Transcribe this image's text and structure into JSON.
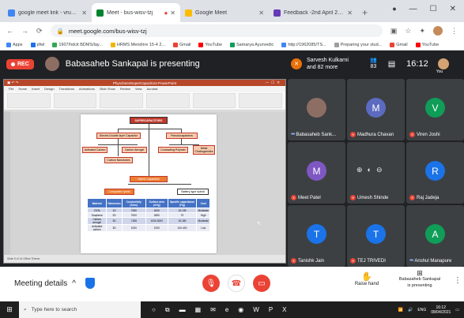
{
  "browser": {
    "tabs": [
      {
        "title": "google meet link - vrushali@...",
        "fav_color": "#4285f4",
        "active": false
      },
      {
        "title": "Meet - bus-wisv-tzj",
        "fav_color": "#00832d",
        "active": true
      },
      {
        "title": "Google Meet",
        "fav_color": "#fbbc04",
        "active": false
      },
      {
        "title": "Feedback -2nd April 2021 - Goo...",
        "fav_color": "#673ab7",
        "active": false
      }
    ],
    "url": "meet.google.com/bus-wisv-tzj",
    "bookmarks": [
      "Apps",
      "pfwl",
      "1907/hdcit BDMS/lay...",
      "HRMS Mendrire 15-4 2...",
      "Gmail",
      "YouTube",
      "Samarya Ayurvedic",
      "http://1962085/TS...",
      "Preparing your stud...",
      "Gmail",
      "YouTube"
    ],
    "win_controls": [
      "—",
      "☐",
      "✕"
    ]
  },
  "meet": {
    "rec_label": "REC",
    "presenting_text": "Babasaheb Sankapal is presenting",
    "host_line1": "Sarvesh Kulkarni",
    "host_line2": "and 82 more",
    "people_count": "83",
    "clock": "16:12",
    "you_label": "You"
  },
  "ppt": {
    "window_title": "PhyschemISuperCapacitors-PowerPoint",
    "menu": [
      "File",
      "Home",
      "Insert",
      "Design",
      "Transitions",
      "Animations",
      "Slide Show",
      "Review",
      "View",
      "Acrobat"
    ],
    "status": "Slide 9 of 14    Office Theme",
    "slide": {
      "title": "SUPERCAPACITORS",
      "nodes": {
        "edlc": "Electric Double layer Capacitor",
        "pseudo": "Pseudocapacitors",
        "activated": "Activated Carbon",
        "carbon_aerogel": "Carbon Aerogel",
        "conducting": "Conducting Polymer",
        "metal": "Metal Chalcogenides",
        "nanotubes": "Carbon Nanotubes",
        "hybrid": "Hybrid Capacitors",
        "composite": "Composite hybrid",
        "battery": "Battery-type hybrid"
      },
      "table": {
        "headers": [
          "Material",
          "Dimension",
          "Conductivity (S/cm)",
          "Surface area (m²/g)",
          "Specific capacitance (F/g)",
          "Cost"
        ],
        "rows": [
          [
            "CNTs",
            "1D",
            "7080",
            "4000",
            "15-135",
            "Moderate"
          ],
          [
            "Graphene",
            "2D",
            "7000",
            "2690",
            "70",
            "High"
          ],
          [
            "Carbon aerogel",
            "3D",
            "7185",
            "1000-3000",
            "15-180",
            "Moderate"
          ],
          [
            "Activated carbon",
            "3D",
            "1000",
            "1000",
            "100-400",
            "Low"
          ]
        ]
      }
    }
  },
  "participants": [
    {
      "name": "Babasaheb Sank...",
      "initial": "",
      "color": "#8d6e63",
      "photo": true,
      "muted": false
    },
    {
      "name": "Madhura Chavan",
      "initial": "M",
      "color": "#5c6bc0",
      "photo": false,
      "muted": true
    },
    {
      "name": "Viren Joshi",
      "initial": "V",
      "color": "#0f9d58",
      "photo": false,
      "muted": true
    },
    {
      "name": "Meet Patel",
      "initial": "M",
      "color": "#7e57c2",
      "photo": false,
      "muted": true
    },
    {
      "name": "Umesh Shinde",
      "initial": "",
      "color": "#3c4043",
      "photo": false,
      "muted": true
    },
    {
      "name": "Raj Jadeja",
      "initial": "R",
      "color": "#1a73e8",
      "photo": false,
      "muted": true
    },
    {
      "name": "Tanishk Jain",
      "initial": "T",
      "color": "#1a73e8",
      "photo": false,
      "muted": true
    },
    {
      "name": "TEJ TRIVEDI",
      "initial": "T",
      "color": "#1a73e8",
      "photo": false,
      "muted": true
    },
    {
      "name": "Anshul Manapure",
      "initial": "A",
      "color": "#0f9d58",
      "photo": false,
      "muted": false
    }
  ],
  "bottom": {
    "meeting_details": "Meeting details",
    "raise_hand": "Raise hand",
    "presenting_line1": "Babasaheb Sankapal",
    "presenting_line2": "is presenting"
  },
  "taskbar": {
    "search_placeholder": "Type here to search",
    "time": "16:12",
    "date": "08/04/2021",
    "lang": "ENG"
  }
}
